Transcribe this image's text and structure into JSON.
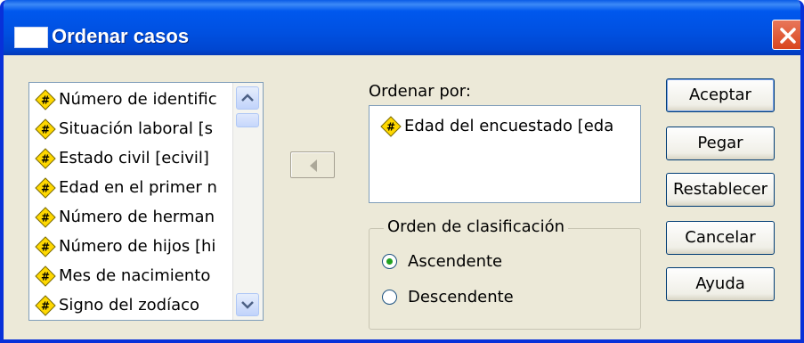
{
  "window": {
    "title": "Ordenar casos"
  },
  "variables": [
    {
      "label": "Número de identific",
      "icon": "numeric-variable-icon"
    },
    {
      "label": "Situación laboral [s",
      "icon": "numeric-variable-icon"
    },
    {
      "label": "Estado civil [ecivil]",
      "icon": "numeric-variable-icon"
    },
    {
      "label": "Edad en el primer n",
      "icon": "numeric-variable-icon"
    },
    {
      "label": "Número de herman",
      "icon": "numeric-variable-icon"
    },
    {
      "label": "Número de hijos [hi",
      "icon": "numeric-variable-icon"
    },
    {
      "label": "Mes de nacimiento",
      "icon": "numeric-variable-icon"
    },
    {
      "label": "Signo del zodíaco",
      "icon": "numeric-variable-icon"
    }
  ],
  "sort_by": {
    "label": "Ordenar por:",
    "items": [
      {
        "label": "Edad del encuestado [eda",
        "icon": "numeric-variable-icon"
      }
    ]
  },
  "order": {
    "legend": "Orden de clasificación",
    "options": [
      {
        "label": "Ascendente",
        "selected": true
      },
      {
        "label": "Descendente",
        "selected": false
      }
    ]
  },
  "buttons": {
    "accept": "Aceptar",
    "paste": "Pegar",
    "reset": "Restablecer",
    "cancel": "Cancelar",
    "help": "Ayuda"
  },
  "colors": {
    "titlebar": "#0054e3",
    "dialog": "#ece9d8",
    "close_button": "#d9461e",
    "variable_icon": "#ffd800"
  }
}
